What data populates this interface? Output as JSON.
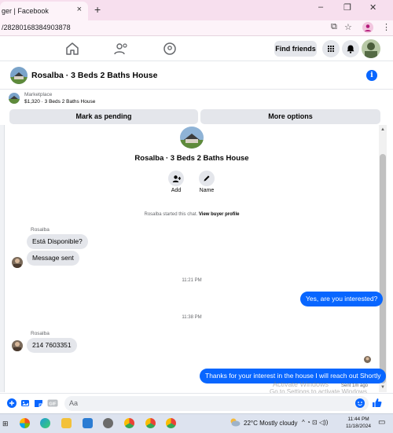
{
  "browser": {
    "tab_title": "ger | Facebook",
    "tab_close": "×",
    "new_tab": "+",
    "url": "/28280168384903878",
    "window_controls": [
      "–",
      "❐",
      "✕"
    ]
  },
  "nav": {
    "icons": [
      "home-icon",
      "friends-icon",
      "groups-icon"
    ],
    "find_friends": "Find friends"
  },
  "chat": {
    "title": "Rosalba · 3 Beds 2 Baths House",
    "marketplace_label": "Marketplace",
    "marketplace_sub": "$1,320 · 3 Beds 2 Baths House",
    "mark_pending": "Mark as pending",
    "more_options": "More options",
    "profile_name": "Rosalba · 3 Beds 2 Baths House",
    "add_label": "Add",
    "name_label": "Name",
    "started_text": "Rosalba started this chat.",
    "view_profile": "View buyer profile"
  },
  "messages": {
    "sender1": "Rosalba",
    "msg1": "Está Disponible?",
    "msg2": "Message sent",
    "time1": "11:21 PM",
    "out1": "Yes, are you interested?",
    "time2": "11:38 PM",
    "sender2": "Rosalba",
    "msg3": "214 7603351",
    "out2": "Thanks for your interest in the house I will reach out Shortly",
    "sent_note": "Sent 1m ago"
  },
  "watermark": {
    "line1": "Activate Windows",
    "line2": "Go to Settings to activate Windows."
  },
  "composer": {
    "placeholder": "Aa"
  },
  "taskbar": {
    "weather": "22°C  Mostly cloudy",
    "time": "11:44 PM",
    "date": "11/18/2024"
  },
  "colors": {
    "accent": "#0866ff",
    "bubble_in": "#e4e6eb",
    "tabstrip": "#f7dfee"
  }
}
